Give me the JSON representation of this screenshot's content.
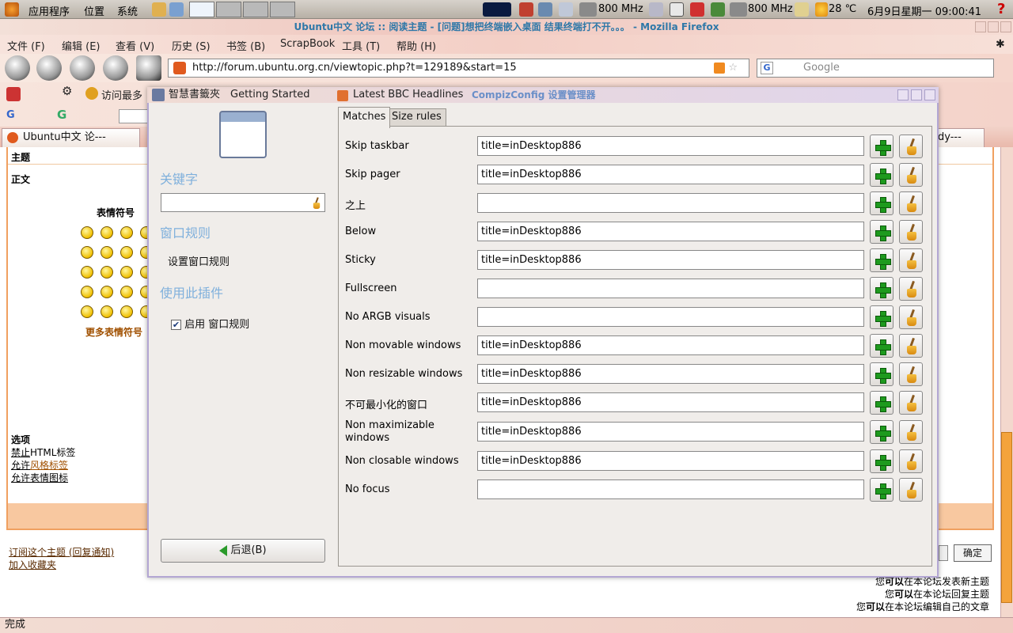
{
  "panel": {
    "menus": [
      "应用程序",
      "位置",
      "系统"
    ],
    "cpu1": "800 MHz",
    "cpu2": "800 MHz",
    "weather": "28 ℃",
    "datetime": "6月9日星期一 09:00:41"
  },
  "firefox": {
    "title": "Ubuntu中文 论坛 :: 阅读主题 - [问题]想把终端嵌入桌面 结果终端打不开。。。 - Mozilla Firefox",
    "menus": [
      "文件 (F)",
      "编辑 (E)",
      "查看 (V)",
      "历史 (S)",
      "书签 (B)",
      "ScrapBook",
      "工具 (T)",
      "帮助 (H)"
    ],
    "url": "http://forum.ubuntu.org.cn/viewtopic.php?t=129189&start=15",
    "search_placeholder": "Google",
    "bookmarks": [
      "访问最多",
      "智慧書籤夾",
      "Getting Started",
      "Latest BBC Headlines"
    ],
    "tab_label": "Ubuntu中文 论---",
    "tab_right": "dy---",
    "status": "完成"
  },
  "forum": {
    "subject_label": "主题",
    "body_label": "正文",
    "smilies_title": "表情符号",
    "more_smilies": "更多表情符号",
    "options_title": "选项",
    "option1_a": "禁止",
    "option1_b": "HTML标签",
    "option2_a": "允许",
    "option2_b": "风格标签",
    "option3": "允许表情图标",
    "subscribe": "订阅这个主题 (回复通知)",
    "favorite": "加入收藏夹",
    "confirm": "确定",
    "perm1_a": "您",
    "perm1_b": "可以",
    "perm1_c": "在本论坛发表新主题",
    "perm2_a": "您",
    "perm2_b": "可以",
    "perm2_c": "在本论坛回复主题",
    "perm3_a": "您",
    "perm3_b": "可以",
    "perm3_c": "在本论坛编辑自己的文章"
  },
  "dialog": {
    "title": "CompizConfig 设置管理器",
    "keyword_heading": "关键字",
    "category_heading": "窗口规则",
    "category_item": "设置窗口规则",
    "use_plugin_heading": "使用此插件",
    "enable_label": "启用 窗口规则",
    "enable_checked": true,
    "back_label": "后退(B)",
    "tabs": [
      "Matches",
      "Size rules"
    ],
    "rows": [
      {
        "label": "Skip taskbar",
        "value": "title=inDesktop886"
      },
      {
        "label": "Skip pager",
        "value": "title=inDesktop886"
      },
      {
        "label": "之上",
        "value": ""
      },
      {
        "label": "Below",
        "value": "title=inDesktop886"
      },
      {
        "label": "Sticky",
        "value": "title=inDesktop886"
      },
      {
        "label": "Fullscreen",
        "value": ""
      },
      {
        "label": "No ARGB visuals",
        "value": ""
      },
      {
        "label": "Non movable windows",
        "value": "title=inDesktop886"
      },
      {
        "label": "Non resizable windows",
        "value": "title=inDesktop886"
      },
      {
        "label": "不可最小化的窗口",
        "value": "title=inDesktop886"
      },
      {
        "label": "Non maximizable windows",
        "value": "title=inDesktop886"
      },
      {
        "label": "Non closable windows",
        "value": "title=inDesktop886"
      },
      {
        "label": "No focus",
        "value": ""
      }
    ]
  }
}
